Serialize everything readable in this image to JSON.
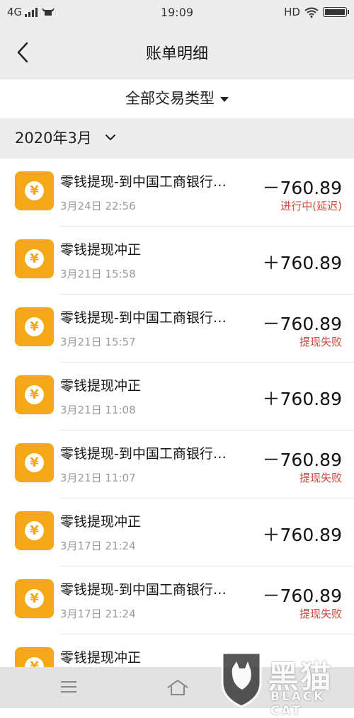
{
  "status_bar": {
    "network": "4G",
    "time": "19:09",
    "hd": "HD"
  },
  "header": {
    "title": "账单明细"
  },
  "filter": {
    "label": "全部交易类型"
  },
  "month": {
    "label": "2020年3月"
  },
  "transactions": [
    {
      "title": "零钱提现-到中国工商银行…",
      "datetime": "3月24日 22:56",
      "amount": "－760.89",
      "status": "进行中(延迟)"
    },
    {
      "title": "零钱提现冲正",
      "datetime": "3月21日 15:58",
      "amount": "＋760.89",
      "status": ""
    },
    {
      "title": "零钱提现-到中国工商银行…",
      "datetime": "3月21日 15:57",
      "amount": "－760.89",
      "status": "提现失败"
    },
    {
      "title": "零钱提现冲正",
      "datetime": "3月21日 11:08",
      "amount": "＋760.89",
      "status": ""
    },
    {
      "title": "零钱提现-到中国工商银行…",
      "datetime": "3月21日 11:07",
      "amount": "－760.89",
      "status": "提现失败"
    },
    {
      "title": "零钱提现冲正",
      "datetime": "3月17日 21:24",
      "amount": "＋760.89",
      "status": ""
    },
    {
      "title": "零钱提现-到中国工商银行…",
      "datetime": "3月17日 21:24",
      "amount": "－760.89",
      "status": "提现失败"
    },
    {
      "title": "零钱提现冲正",
      "datetime": "",
      "amount": "",
      "status": ""
    }
  ],
  "watermark": {
    "cn": "黑猫",
    "en": "BLACK CAT"
  },
  "colors": {
    "icon_bg": "#f5a815",
    "status_red": "#d1493b",
    "bar_bg": "#ededed"
  },
  "icons": {
    "back": "chevron-left-icon",
    "filter_caret": "caret-down-icon",
    "month_chevron": "chevron-down-icon",
    "transaction": "yuan-coin-icon",
    "nav_menu": "menu-icon",
    "nav_home": "home-icon"
  }
}
